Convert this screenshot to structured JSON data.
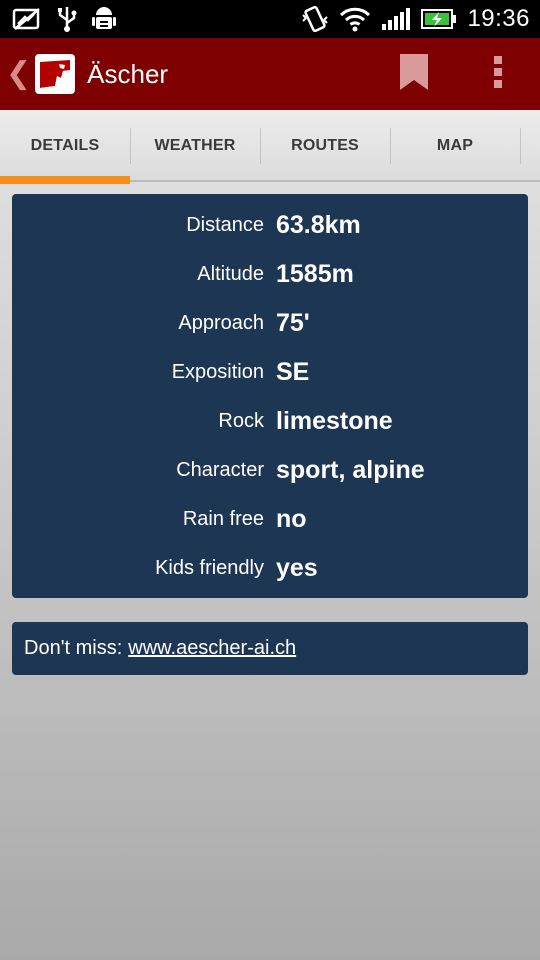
{
  "status_bar": {
    "time": "19:36",
    "icons": [
      "screenshot-icon",
      "usb-icon",
      "android-debug-icon",
      "vibrate-icon",
      "wifi-icon",
      "signal-icon",
      "battery-charging-icon"
    ],
    "battery_color": "#39c23a"
  },
  "app_bar": {
    "title": "Äscher",
    "back_glyph": "❮",
    "background": "#7e0000",
    "icons": [
      "app-logo-icon",
      "bookmark-icon",
      "overflow-menu-icon"
    ]
  },
  "tabs": [
    {
      "label": "DETAILS",
      "active": true
    },
    {
      "label": "WEATHER",
      "active": false
    },
    {
      "label": "ROUTES",
      "active": false
    },
    {
      "label": "MAP",
      "active": false
    }
  ],
  "accent_color": "#f28e1c",
  "details": [
    {
      "label": "Distance",
      "value": "63.8km"
    },
    {
      "label": "Altitude",
      "value": "1585m"
    },
    {
      "label": "Approach",
      "value": "75'"
    },
    {
      "label": "Exposition",
      "value": "SE"
    },
    {
      "label": "Rock",
      "value": "limestone"
    },
    {
      "label": "Character",
      "value": "sport, alpine"
    },
    {
      "label": "Rain free",
      "value": "no"
    },
    {
      "label": "Kids friendly",
      "value": "yes"
    }
  ],
  "tip": {
    "prefix": "Don't miss:",
    "link": "www.aescher-ai.ch"
  },
  "card_color": "#1d3653"
}
